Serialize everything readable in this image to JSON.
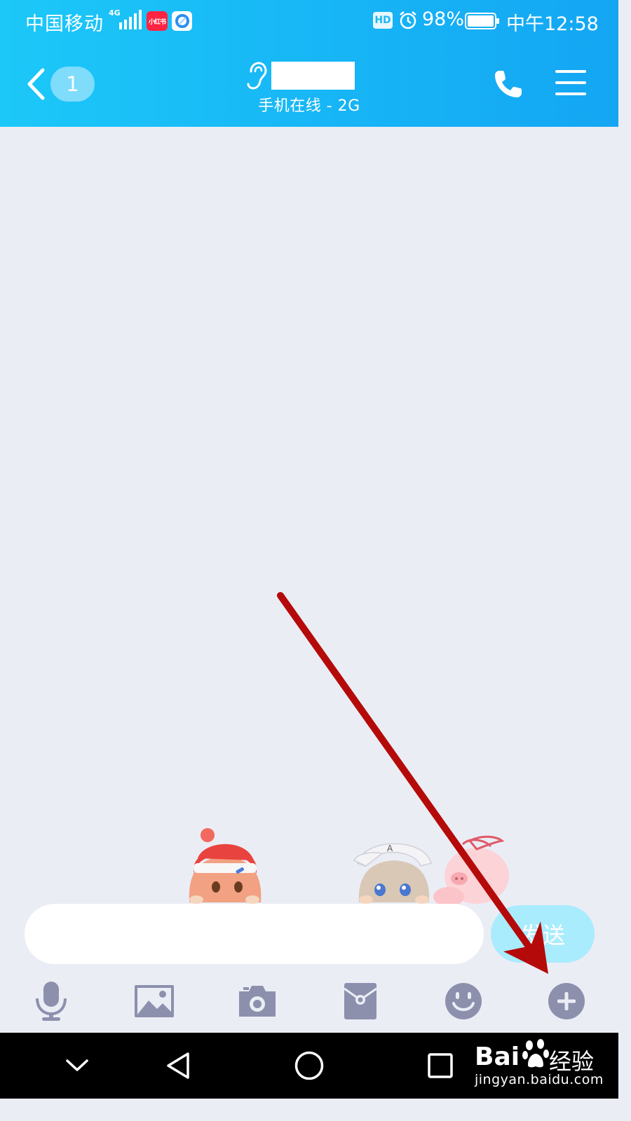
{
  "status_bar": {
    "carrier": "中国移动",
    "network": "4G",
    "app_badge": "小红书",
    "hd": "HD",
    "battery": "98%",
    "time": "中午12:58"
  },
  "title_bar": {
    "unread_count": "1",
    "contact_name": "",
    "online_status": "手机在线 - 2G"
  },
  "input": {
    "value": "",
    "placeholder": "",
    "send_label": "发送"
  },
  "toolbar": {
    "items": [
      {
        "icon": "microphone-icon"
      },
      {
        "icon": "image-icon"
      },
      {
        "icon": "camera-icon"
      },
      {
        "icon": "red-packet-icon"
      },
      {
        "icon": "emoji-icon"
      },
      {
        "icon": "plus-icon"
      }
    ]
  },
  "watermark": {
    "brand": "Bai",
    "brand_cn": "经验",
    "url": "jingyan.baidu.com"
  },
  "colors": {
    "header_start": "#1cc8f8",
    "header_end": "#14a6f3",
    "chat_bg": "#ebedf5",
    "toolbar_icon": "#8c90ad",
    "send_button": "#a9ecfd",
    "annotation": "#b50a0a"
  }
}
